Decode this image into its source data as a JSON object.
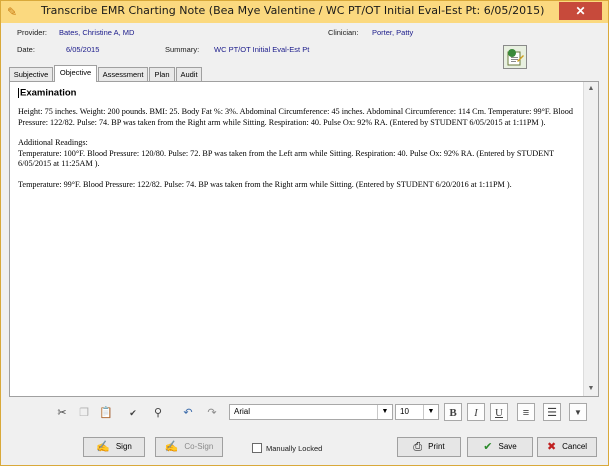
{
  "window": {
    "title": "Transcribe EMR Charting Note (Bea Mye Valentine / WC PT/OT  Initial Eval-Est Pt:  6/05/2015)",
    "close_label": "✕"
  },
  "header": {
    "provider_label": "Provider:",
    "provider_value": "Bates, Christine A, MD",
    "clinician_label": "Clinician:",
    "clinician_value": "Porter, Patty",
    "date_label": "Date:",
    "date_value": "6/05/2015",
    "summary_label": "Summary:",
    "summary_value": "WC PT/OT  Initial Eval-Est Pt"
  },
  "tabs": [
    {
      "label": "Subjective",
      "active": false
    },
    {
      "label": "Objective",
      "active": true
    },
    {
      "label": "Assessment",
      "active": false
    },
    {
      "label": "Plan",
      "active": false
    },
    {
      "label": "Audit",
      "active": false
    }
  ],
  "editor": {
    "heading": "Examination",
    "para1": "Height: 75 inches. Weight: 200 pounds. BMI: 25. Body Fat %: 3%. Abdominal Circumference: 45 inches. Abdominal Circumference: 114 Cm. Temperature: 99°F. Blood Pressure: 122/82. Pulse: 74. BP was taken from the Right arm while Sitting. Respiration: 40. Pulse Ox: 92% RA.  (Entered by STUDENT  6/05/2015 at  1:11PM ).",
    "para2_title": "Additional Readings:",
    "para2": "Temperature: 100°F. Blood Pressure: 120/80. Pulse: 72. BP was taken from the Left arm while Sitting. Respiration: 40. Pulse Ox: 92% RA. (Entered by STUDENT  6/05/2015 at 11:25AM ).",
    "para3": "Temperature: 99°F. Blood Pressure: 122/82. Pulse: 74. BP was taken from the Right arm while Sitting. (Entered by STUDENT  6/20/2016 at 1:11PM )."
  },
  "toolbar": {
    "font_value": "Arial",
    "size_value": "10",
    "bold_label": "B",
    "italic_label": "I",
    "underline_label": "U"
  },
  "footer": {
    "sign_label": "Sign",
    "cosign_label": "Co-Sign",
    "manually_locked_label": "Manually Locked",
    "print_label": "Print",
    "save_label": "Save",
    "cancel_label": "Cancel"
  }
}
